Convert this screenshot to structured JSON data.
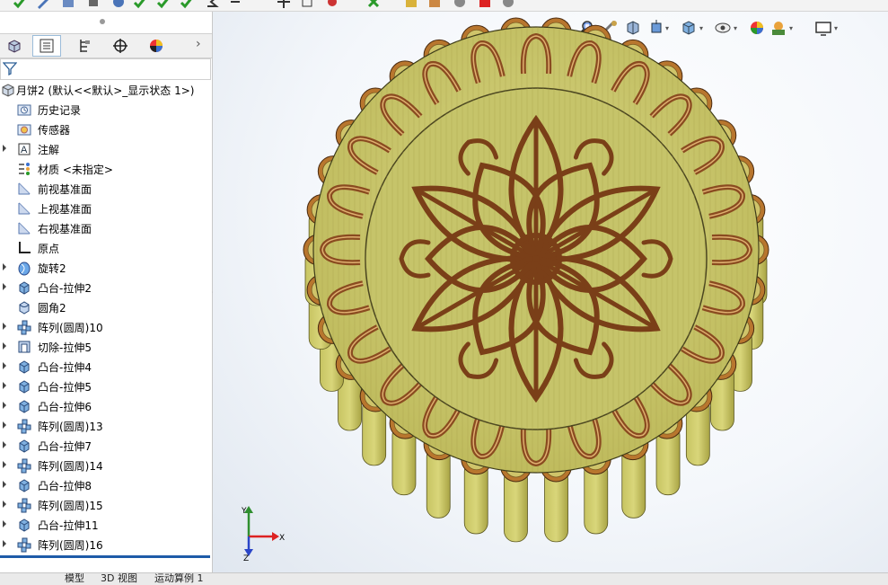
{
  "feature_tree": {
    "root": "月饼2  (默认<<默认>_显示状态 1>)",
    "items": [
      {
        "label": "历史记录",
        "icon": "history-folder-icon",
        "expand": false
      },
      {
        "label": "传感器",
        "icon": "sensor-icon",
        "expand": false
      },
      {
        "label": "注解",
        "icon": "annotation-icon",
        "expand": true
      },
      {
        "label": "材质 <未指定>",
        "icon": "material-icon",
        "expand": false
      },
      {
        "label": "前视基准面",
        "icon": "plane-icon",
        "expand": false
      },
      {
        "label": "上视基准面",
        "icon": "plane-icon",
        "expand": false
      },
      {
        "label": "右视基准面",
        "icon": "plane-icon",
        "expand": false
      },
      {
        "label": "原点",
        "icon": "origin-icon",
        "expand": false
      },
      {
        "label": "旋转2",
        "icon": "revolve-icon",
        "expand": true
      },
      {
        "label": "凸台-拉伸2",
        "icon": "extrude-icon",
        "expand": true
      },
      {
        "label": "圆角2",
        "icon": "fillet-icon",
        "expand": false
      },
      {
        "label": "阵列(圆周)10",
        "icon": "circular-pattern-icon",
        "expand": true
      },
      {
        "label": "切除-拉伸5",
        "icon": "cut-extrude-icon",
        "expand": true
      },
      {
        "label": "凸台-拉伸4",
        "icon": "extrude-icon",
        "expand": true
      },
      {
        "label": "凸台-拉伸5",
        "icon": "extrude-icon",
        "expand": true
      },
      {
        "label": "凸台-拉伸6",
        "icon": "extrude-icon",
        "expand": true
      },
      {
        "label": "阵列(圆周)13",
        "icon": "circular-pattern-icon",
        "expand": true
      },
      {
        "label": "凸台-拉伸7",
        "icon": "extrude-icon",
        "expand": true
      },
      {
        "label": "阵列(圆周)14",
        "icon": "circular-pattern-icon",
        "expand": true
      },
      {
        "label": "凸台-拉伸8",
        "icon": "extrude-icon",
        "expand": true
      },
      {
        "label": "阵列(圆周)15",
        "icon": "circular-pattern-icon",
        "expand": true
      },
      {
        "label": "凸台-拉伸11",
        "icon": "extrude-icon",
        "expand": true
      },
      {
        "label": "阵列(圆周)16",
        "icon": "circular-pattern-icon",
        "expand": true
      }
    ]
  },
  "bottom_tabs": [
    "模型",
    "3D 视图",
    "运动算例 1"
  ],
  "triad": {
    "x": "X",
    "y": "Y",
    "z": "Z"
  },
  "colors": {
    "accent": "#1e5ba8",
    "wood_light": "#c9c76a",
    "wood_dark": "#8a4b20",
    "rim": "#b8762e"
  }
}
